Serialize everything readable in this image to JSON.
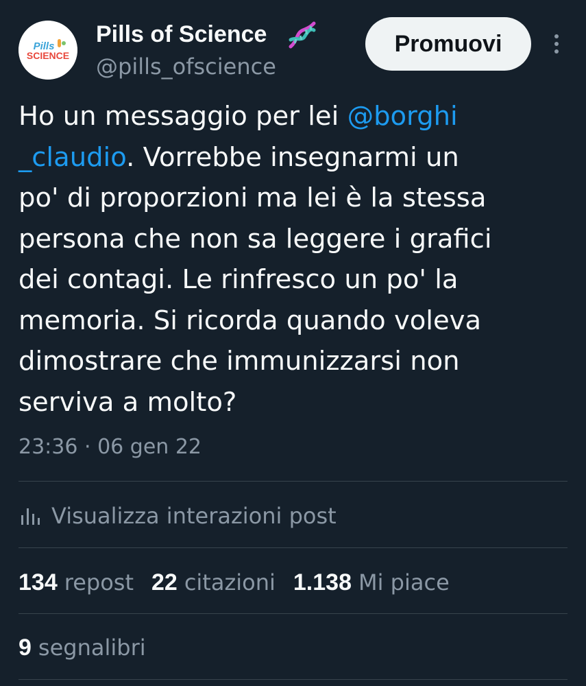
{
  "author": {
    "display_name": "Pills of Science",
    "handle": "@pills_ofscience",
    "avatar_logo_text": [
      "Pills",
      "SCIENCE"
    ]
  },
  "header": {
    "promote_label": "Promuovi"
  },
  "tweet": {
    "text_before_mention": "Ho un messaggio per lei ",
    "mention": "@borghi\n_claudio",
    "text_after_mention": ". Vorrebbe insegnarmi un\npo' di proporzioni ma lei è la stessa\npersona che non sa leggere i grafici\ndei contagi. Le rinfresco un po' la\nmemoria. Si ricorda quando voleva\ndimostrare che immunizzarsi non\nserviva a molto?",
    "timestamp": "23:36 · 06 gen 22"
  },
  "analytics": {
    "label": "Visualizza interazioni post"
  },
  "stats": [
    {
      "num": "134",
      "label": "repost"
    },
    {
      "num": "22",
      "label": "citazioni"
    },
    {
      "num": "1.138",
      "label": "Mi piace"
    }
  ],
  "stats2": [
    {
      "num": "9",
      "label": "segnalibri"
    }
  ],
  "colors": {
    "background": "#15202b",
    "text": "#f7f9f9",
    "secondary_text": "#8b98a5",
    "link": "#1d9bf0",
    "divider": "#38444d",
    "button_bg": "#eff3f4"
  },
  "icons": {
    "more": "more-vertical-icon",
    "analytics": "bar-chart-icon",
    "emoji": "dna-icon"
  }
}
